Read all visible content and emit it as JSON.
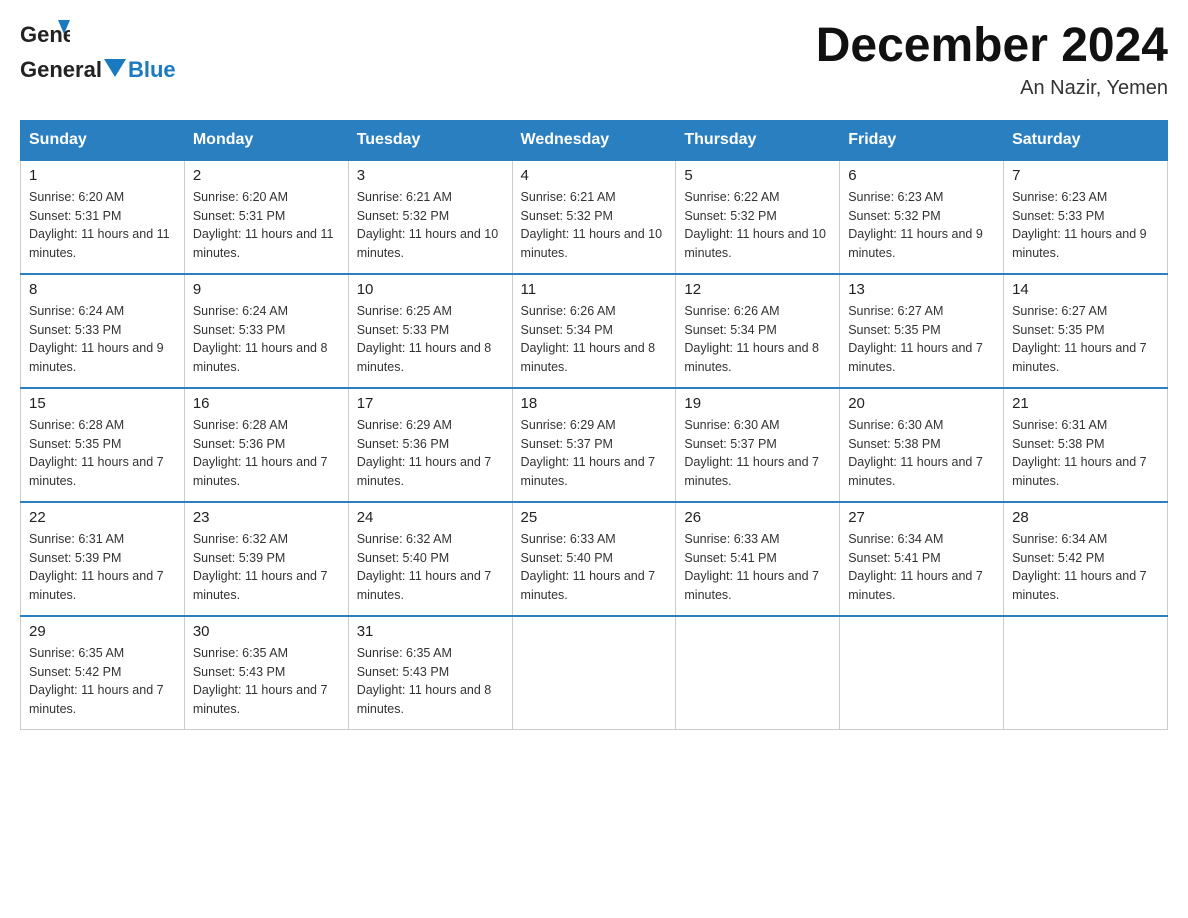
{
  "header": {
    "logo_general": "General",
    "logo_blue": "Blue",
    "month_title": "December 2024",
    "location": "An Nazir, Yemen"
  },
  "weekdays": [
    "Sunday",
    "Monday",
    "Tuesday",
    "Wednesday",
    "Thursday",
    "Friday",
    "Saturday"
  ],
  "weeks": [
    [
      {
        "day": "1",
        "sunrise": "6:20 AM",
        "sunset": "5:31 PM",
        "daylight": "11 hours and 11 minutes."
      },
      {
        "day": "2",
        "sunrise": "6:20 AM",
        "sunset": "5:31 PM",
        "daylight": "11 hours and 11 minutes."
      },
      {
        "day": "3",
        "sunrise": "6:21 AM",
        "sunset": "5:32 PM",
        "daylight": "11 hours and 10 minutes."
      },
      {
        "day": "4",
        "sunrise": "6:21 AM",
        "sunset": "5:32 PM",
        "daylight": "11 hours and 10 minutes."
      },
      {
        "day": "5",
        "sunrise": "6:22 AM",
        "sunset": "5:32 PM",
        "daylight": "11 hours and 10 minutes."
      },
      {
        "day": "6",
        "sunrise": "6:23 AM",
        "sunset": "5:32 PM",
        "daylight": "11 hours and 9 minutes."
      },
      {
        "day": "7",
        "sunrise": "6:23 AM",
        "sunset": "5:33 PM",
        "daylight": "11 hours and 9 minutes."
      }
    ],
    [
      {
        "day": "8",
        "sunrise": "6:24 AM",
        "sunset": "5:33 PM",
        "daylight": "11 hours and 9 minutes."
      },
      {
        "day": "9",
        "sunrise": "6:24 AM",
        "sunset": "5:33 PM",
        "daylight": "11 hours and 8 minutes."
      },
      {
        "day": "10",
        "sunrise": "6:25 AM",
        "sunset": "5:33 PM",
        "daylight": "11 hours and 8 minutes."
      },
      {
        "day": "11",
        "sunrise": "6:26 AM",
        "sunset": "5:34 PM",
        "daylight": "11 hours and 8 minutes."
      },
      {
        "day": "12",
        "sunrise": "6:26 AM",
        "sunset": "5:34 PM",
        "daylight": "11 hours and 8 minutes."
      },
      {
        "day": "13",
        "sunrise": "6:27 AM",
        "sunset": "5:35 PM",
        "daylight": "11 hours and 7 minutes."
      },
      {
        "day": "14",
        "sunrise": "6:27 AM",
        "sunset": "5:35 PM",
        "daylight": "11 hours and 7 minutes."
      }
    ],
    [
      {
        "day": "15",
        "sunrise": "6:28 AM",
        "sunset": "5:35 PM",
        "daylight": "11 hours and 7 minutes."
      },
      {
        "day": "16",
        "sunrise": "6:28 AM",
        "sunset": "5:36 PM",
        "daylight": "11 hours and 7 minutes."
      },
      {
        "day": "17",
        "sunrise": "6:29 AM",
        "sunset": "5:36 PM",
        "daylight": "11 hours and 7 minutes."
      },
      {
        "day": "18",
        "sunrise": "6:29 AM",
        "sunset": "5:37 PM",
        "daylight": "11 hours and 7 minutes."
      },
      {
        "day": "19",
        "sunrise": "6:30 AM",
        "sunset": "5:37 PM",
        "daylight": "11 hours and 7 minutes."
      },
      {
        "day": "20",
        "sunrise": "6:30 AM",
        "sunset": "5:38 PM",
        "daylight": "11 hours and 7 minutes."
      },
      {
        "day": "21",
        "sunrise": "6:31 AM",
        "sunset": "5:38 PM",
        "daylight": "11 hours and 7 minutes."
      }
    ],
    [
      {
        "day": "22",
        "sunrise": "6:31 AM",
        "sunset": "5:39 PM",
        "daylight": "11 hours and 7 minutes."
      },
      {
        "day": "23",
        "sunrise": "6:32 AM",
        "sunset": "5:39 PM",
        "daylight": "11 hours and 7 minutes."
      },
      {
        "day": "24",
        "sunrise": "6:32 AM",
        "sunset": "5:40 PM",
        "daylight": "11 hours and 7 minutes."
      },
      {
        "day": "25",
        "sunrise": "6:33 AM",
        "sunset": "5:40 PM",
        "daylight": "11 hours and 7 minutes."
      },
      {
        "day": "26",
        "sunrise": "6:33 AM",
        "sunset": "5:41 PM",
        "daylight": "11 hours and 7 minutes."
      },
      {
        "day": "27",
        "sunrise": "6:34 AM",
        "sunset": "5:41 PM",
        "daylight": "11 hours and 7 minutes."
      },
      {
        "day": "28",
        "sunrise": "6:34 AM",
        "sunset": "5:42 PM",
        "daylight": "11 hours and 7 minutes."
      }
    ],
    [
      {
        "day": "29",
        "sunrise": "6:35 AM",
        "sunset": "5:42 PM",
        "daylight": "11 hours and 7 minutes."
      },
      {
        "day": "30",
        "sunrise": "6:35 AM",
        "sunset": "5:43 PM",
        "daylight": "11 hours and 7 minutes."
      },
      {
        "day": "31",
        "sunrise": "6:35 AM",
        "sunset": "5:43 PM",
        "daylight": "11 hours and 8 minutes."
      },
      null,
      null,
      null,
      null
    ]
  ]
}
